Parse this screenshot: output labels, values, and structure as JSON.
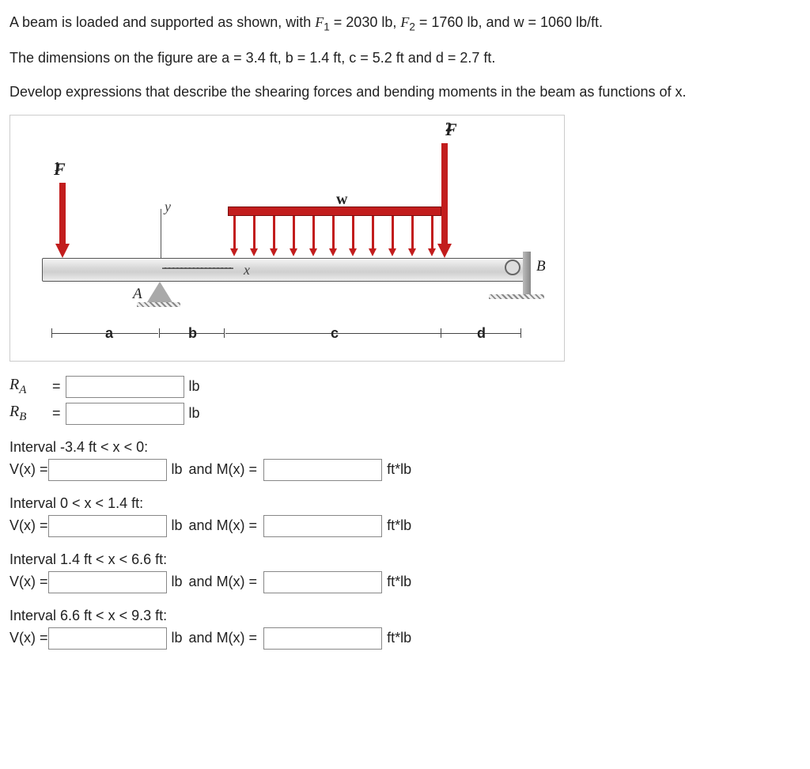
{
  "problem": {
    "line1_pre": "A beam is loaded and supported as shown, with ",
    "f1_sym": "F",
    "f1_sub": "1",
    "f1_val": " = 2030 lb, ",
    "f2_sym": "F",
    "f2_sub": "2",
    "f2_val": " = 1760 lb, and w = 1060 lb/ft.",
    "line2": "The dimensions on the figure are a = 3.4 ft, b = 1.4 ft, c = 5.2 ft and d = 2.7 ft.",
    "line3": "Develop expressions that describe the shearing forces and bending moments in the beam as functions of x."
  },
  "figure": {
    "F1": "F",
    "F1sub": "1",
    "F2": "F",
    "F2sub": "2",
    "w": "w",
    "y": "y",
    "x": "x",
    "A": "A",
    "B": "B",
    "dim_a": "a",
    "dim_b": "b",
    "dim_c": "c",
    "dim_d": "d"
  },
  "reactions": {
    "RA_sym": "R",
    "RA_sub": "A",
    "eq": " = ",
    "RB_sym": "R",
    "RB_sub": "B",
    "unit": "lb"
  },
  "intervals": [
    {
      "title": "Interval -3.4 ft < x < 0:",
      "v": "V(x) = ",
      "vunit": "lb",
      "and": " and M(x) = ",
      "munit": "ft*lb"
    },
    {
      "title": "Interval 0 < x < 1.4 ft:",
      "v": "V(x) = ",
      "vunit": "lb",
      "and": " and M(x) = ",
      "munit": "ft*lb"
    },
    {
      "title": "Interval 1.4 ft < x < 6.6 ft:",
      "v": "V(x) = ",
      "vunit": "lb",
      "and": " and M(x) = ",
      "munit": "ft*lb"
    },
    {
      "title": "Interval 6.6 ft < x < 9.3 ft:",
      "v": "V(x) = ",
      "vunit": "lb",
      "and": " and M(x) = ",
      "munit": "ft*lb"
    }
  ]
}
